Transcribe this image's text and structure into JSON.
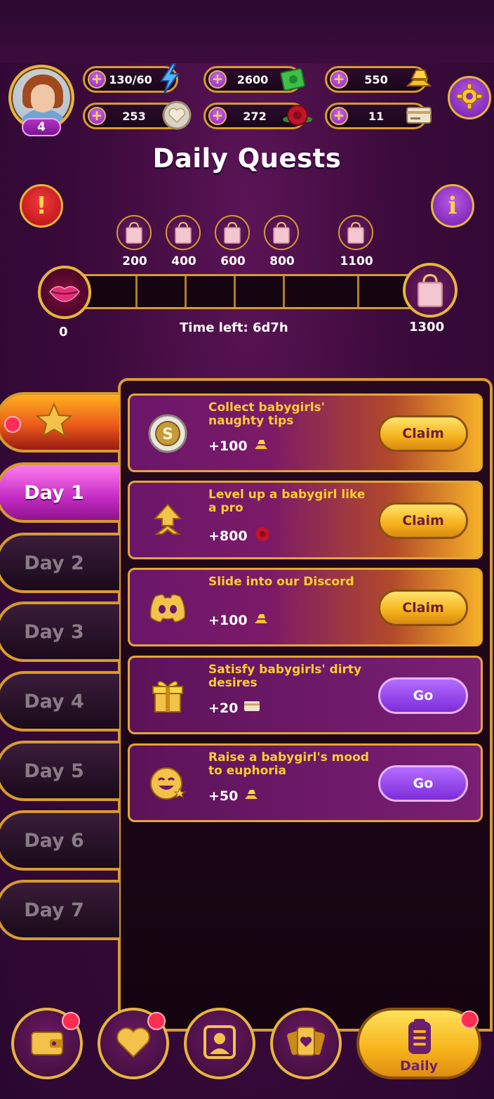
{
  "player": {
    "level": "4"
  },
  "resources": [
    {
      "name": "energy",
      "value": "130/60",
      "icon": "lightning-icon"
    },
    {
      "name": "cash",
      "value": "2600",
      "icon": "cash-icon"
    },
    {
      "name": "gold",
      "value": "550",
      "icon": "gold-bars-icon"
    },
    {
      "name": "hearts",
      "value": "253",
      "icon": "heart-coin-icon"
    },
    {
      "name": "roses",
      "value": "272",
      "icon": "rose-icon"
    },
    {
      "name": "tickets",
      "value": "11",
      "icon": "ticket-icon"
    }
  ],
  "header": {
    "title": "Daily Quests"
  },
  "progress": {
    "start": "0",
    "end": "1300",
    "time_left": "Time left: 6d7h",
    "fill_fraction": 0,
    "milestones": [
      "200",
      "400",
      "600",
      "800",
      "1100"
    ]
  },
  "tabs": [
    "Day 1",
    "Day 2",
    "Day 3",
    "Day 4",
    "Day 5",
    "Day 6",
    "Day 7"
  ],
  "quests": [
    {
      "text": "Collect babygirls' naughty tips",
      "reward": "+100",
      "reward_icon": "gold-bars-icon",
      "icon": "coin-icon",
      "button": "Claim"
    },
    {
      "text": "Level up a babygirl like a pro",
      "reward": "+800",
      "reward_icon": "rose-icon",
      "icon": "level-up-arrow-icon",
      "button": "Claim"
    },
    {
      "text": "Slide into our Discord",
      "reward": "+100",
      "reward_icon": "gold-bars-icon",
      "icon": "discord-icon",
      "button": "Claim"
    },
    {
      "text": "Satisfy babygirls' dirty desires",
      "reward": "+20",
      "reward_icon": "ticket-icon",
      "icon": "gift-icon",
      "button": "Go"
    },
    {
      "text": "Raise a babygirl's mood to euphoria",
      "reward": "+50",
      "reward_icon": "gold-bars-icon",
      "icon": "smile-icon",
      "button": "Go"
    }
  ],
  "nav": {
    "daily_label": "Daily"
  },
  "colors": {
    "gold": "#e6b53c",
    "purple": "#7019a7",
    "accent_red": "#ff2d4f"
  }
}
